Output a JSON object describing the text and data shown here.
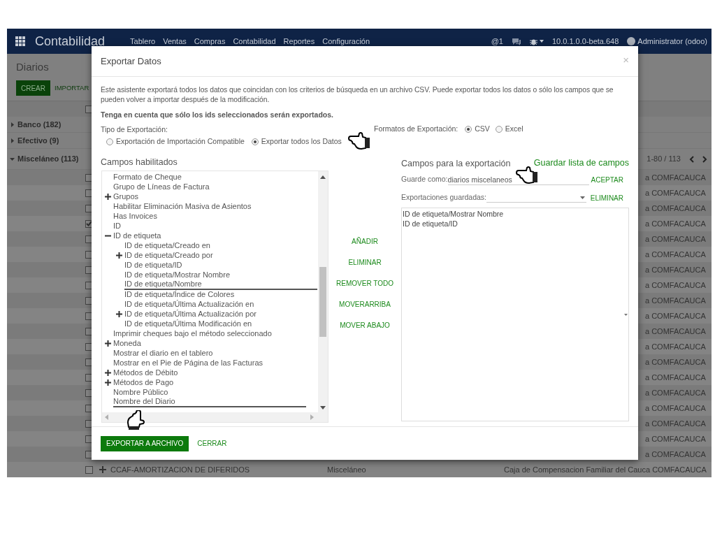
{
  "navbar": {
    "app_title": "Contabilidad",
    "menu": [
      "Tablero",
      "Ventas",
      "Compras",
      "Contabilidad",
      "Reportes",
      "Configuración"
    ],
    "mentions": "@1",
    "version": "10.0.1.0.0-beta.648",
    "user": "Administrator (odoo)"
  },
  "background": {
    "title": "Diarios",
    "create_button": "CREAR",
    "import_button": "IMPORTAR",
    "pager": "1-80 / 113",
    "header_selected": false,
    "groups": [
      {
        "label": "Banco (182)",
        "expanded": false
      },
      {
        "label": "Efectivo (9)",
        "expanded": false
      },
      {
        "label": "Misceláneo (113)",
        "expanded": true
      }
    ],
    "rows": [
      {
        "selected": false,
        "column_3": "a COMFACAUCA"
      },
      {
        "selected": false,
        "column_3": "a COMFACAUCA"
      },
      {
        "selected": false,
        "column_3": "a COMFACAUCA"
      },
      {
        "selected": true,
        "column_3": "a COMFACAUCA"
      },
      {
        "selected": false,
        "column_3": "a COMFACAUCA"
      },
      {
        "selected": false,
        "column_3": "a COMFACAUCA"
      },
      {
        "selected": false,
        "column_3": "a COMFACAUCA"
      },
      {
        "selected": false,
        "column_3": "a COMFACAUCA"
      },
      {
        "selected": false,
        "column_3": "a COMFACAUCA"
      },
      {
        "selected": false,
        "column_3": "a COMFACAUCA"
      },
      {
        "selected": false,
        "column_3": "a COMFACAUCA"
      },
      {
        "selected": false,
        "column_3": "a COMFACAUCA"
      },
      {
        "selected": false,
        "column_3": "a COMFACAUCA"
      },
      {
        "selected": false,
        "column_3": "a COMFACAUCA"
      },
      {
        "selected": false,
        "column_3": "a COMFACAUCA"
      },
      {
        "selected": false,
        "column_3": "a COMFACAUCA"
      },
      {
        "selected": false,
        "column_3": "a COMFACAUCA"
      },
      {
        "selected": false,
        "column_3": "a COMFACAUCA"
      },
      {
        "selected": false,
        "column_3": "a COMFACAUCA"
      }
    ],
    "last_row": {
      "selected": false,
      "name": "CCAF-AMORTIZACION DE DIFERIDOS",
      "type": "Misceláneo",
      "company": "Caja de Compensacion Familiar del Cauca COMFACAUCA"
    }
  },
  "dialog": {
    "title": "Exportar Datos",
    "close": "×",
    "intro": "Este asistente exportará todos los datos que coincidan con los criterios de búsqueda en un archivo CSV. Puede exportar todos los datos o sólo los campos que se pueden volver a importar después de la modificación.",
    "note": "Tenga en cuenta que sólo los ids seleccionados serán exportados.",
    "export_type_label": "Tipo de Exportación:",
    "export_types": [
      {
        "label": "Exportación de Importación Compatible",
        "selected": false
      },
      {
        "label": "Exportar todos los Datos",
        "selected": true
      }
    ],
    "formats_label": "Formatos de Exportación:",
    "formats": [
      {
        "label": "CSV",
        "selected": true
      },
      {
        "label": "Excel",
        "selected": false
      }
    ],
    "available_title": "Campos habilitados",
    "fields": [
      {
        "kind": "leaf",
        "label": "Formato de Cheque",
        "selected": false
      },
      {
        "kind": "leaf",
        "label": "Grupo de Líneas de Factura",
        "selected": false
      },
      {
        "kind": "group",
        "label": "Grupos",
        "selected": false,
        "expanded": false
      },
      {
        "kind": "leaf",
        "label": "Habilitar Eliminación Masiva de Asientos",
        "selected": false
      },
      {
        "kind": "leaf",
        "label": "Has Invoices",
        "selected": false
      },
      {
        "kind": "leaf",
        "label": "ID",
        "selected": false
      },
      {
        "kind": "group",
        "label": "ID de etiqueta",
        "selected": false,
        "expanded": true,
        "children": [
          {
            "kind": "leaf",
            "label": "ID de etiqueta/Creado en",
            "selected": false
          },
          {
            "kind": "group",
            "label": "ID de etiqueta/Creado por",
            "selected": false,
            "expanded": false
          },
          {
            "kind": "leaf",
            "label": "ID de etiqueta/ID",
            "selected": false
          },
          {
            "kind": "leaf",
            "label": "ID de etiqueta/Mostrar Nombre",
            "selected": false
          },
          {
            "kind": "leaf",
            "label": "ID de etiqueta/Nombre",
            "selected": true
          },
          {
            "kind": "leaf",
            "label": "ID de etiqueta/Índice de Colores",
            "selected": false
          },
          {
            "kind": "leaf",
            "label": "ID de etiqueta/Última Actualización en",
            "selected": false
          },
          {
            "kind": "group",
            "label": "ID de etiqueta/Última Actualización por",
            "selected": false,
            "expanded": false
          },
          {
            "kind": "leaf",
            "label": "ID de etiqueta/Última Modificación en",
            "selected": false
          }
        ]
      },
      {
        "kind": "leaf",
        "label": "Imprimir cheques bajo el método seleccionado",
        "selected": false
      },
      {
        "kind": "group",
        "label": "Moneda",
        "selected": false,
        "expanded": false
      },
      {
        "kind": "leaf",
        "label": "Mostrar el diario en el tablero",
        "selected": false
      },
      {
        "kind": "leaf",
        "label": "Mostrar en el Pie de Página de las Facturas",
        "selected": false
      },
      {
        "kind": "group",
        "label": "Métodos de Débito",
        "selected": false,
        "expanded": false
      },
      {
        "kind": "group",
        "label": "Métodos de Pago",
        "selected": false,
        "expanded": false
      },
      {
        "kind": "leaf",
        "label": "Nombre Público",
        "selected": false
      },
      {
        "kind": "leaf",
        "label": "Nombre del Diario",
        "selected": true
      }
    ],
    "actions": [
      "AÑADIR",
      "ELIMINAR",
      "REMOVER TODO",
      "MOVERARRIBA",
      "MOVER ABAJO"
    ],
    "export_title": "Campos para la exportación",
    "save_list_link": "Guardar lista de campos",
    "save_as_label": "Guarde como:",
    "save_as_value": "diarios miscelaneos",
    "accept_button": "ACEPTAR",
    "saved_exports_label": "Exportaciones guardadas:",
    "delete_saved_button": "ELIMINAR",
    "export_fields": [
      "ID de etiqueta/Mostrar Nombre",
      "ID de etiqueta/ID"
    ],
    "export_button": "EXPORTAR A ARCHIVO",
    "close_button": "CERRAR"
  }
}
